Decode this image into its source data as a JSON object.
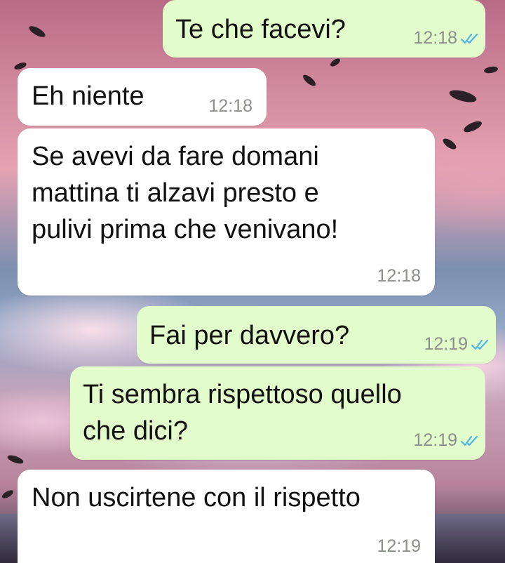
{
  "chat": {
    "messages": [
      {
        "direction": "outgoing",
        "text": "Te che facevi?",
        "time": "12:18",
        "status": "read"
      },
      {
        "direction": "incoming",
        "text": "Eh niente",
        "time": "12:18"
      },
      {
        "direction": "incoming",
        "text": "Se avevi da fare domani\nmattina ti alzavi presto e\npulivi prima che venivano!",
        "time": "12:18"
      },
      {
        "direction": "outgoing",
        "text": "Fai per davvero?",
        "time": "12:19",
        "status": "read"
      },
      {
        "direction": "outgoing",
        "text": "Ti sembra rispettoso quello\nche dici?",
        "time": "12:19",
        "status": "read"
      },
      {
        "direction": "incoming",
        "text": "Non uscirtene con il rispetto",
        "time": "12:19"
      }
    ]
  },
  "colors": {
    "incoming_bubble": "#ffffff",
    "outgoing_bubble": "#e2fdcb",
    "read_ticks": "#4fb6ec",
    "timestamp": "#8b8f8a"
  },
  "icons": {
    "read_receipt": "double-check-icon"
  }
}
